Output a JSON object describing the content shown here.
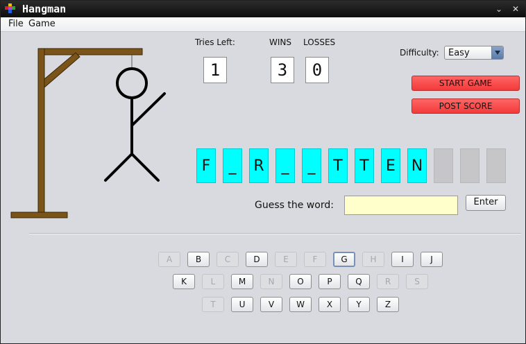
{
  "window": {
    "title": "Hangman"
  },
  "menu": {
    "file": "File",
    "game": "Game"
  },
  "stats": {
    "tries_label": "Tries Left:",
    "tries_value": "1",
    "wins_label": "WINS",
    "wins_value": "3",
    "losses_label": "LOSSES",
    "losses_value": "0"
  },
  "difficulty": {
    "label": "Difficulty:",
    "value": "Easy"
  },
  "buttons": {
    "start": "START GAME",
    "post": "POST SCORE",
    "enter": "Enter"
  },
  "word": {
    "letters": [
      "F",
      "_",
      "R",
      "_",
      "_",
      "T",
      "T",
      "E",
      "N",
      "",
      "",
      ""
    ],
    "filled_count": 9
  },
  "guess": {
    "label": "Guess the word:",
    "value": ""
  },
  "keyboard": {
    "row1": [
      {
        "letter": "A",
        "state": "disabled"
      },
      {
        "letter": "B",
        "state": "enabled"
      },
      {
        "letter": "C",
        "state": "disabled"
      },
      {
        "letter": "D",
        "state": "enabled"
      },
      {
        "letter": "E",
        "state": "disabled"
      },
      {
        "letter": "F",
        "state": "disabled"
      },
      {
        "letter": "G",
        "state": "focused"
      },
      {
        "letter": "H",
        "state": "disabled"
      },
      {
        "letter": "I",
        "state": "enabled"
      },
      {
        "letter": "J",
        "state": "enabled"
      }
    ],
    "row2": [
      {
        "letter": "K",
        "state": "enabled"
      },
      {
        "letter": "L",
        "state": "disabled"
      },
      {
        "letter": "M",
        "state": "enabled"
      },
      {
        "letter": "N",
        "state": "disabled"
      },
      {
        "letter": "O",
        "state": "enabled"
      },
      {
        "letter": "P",
        "state": "enabled"
      },
      {
        "letter": "Q",
        "state": "enabled"
      },
      {
        "letter": "R",
        "state": "disabled"
      },
      {
        "letter": "S",
        "state": "disabled"
      }
    ],
    "row3": [
      {
        "letter": "T",
        "state": "disabled"
      },
      {
        "letter": "U",
        "state": "enabled"
      },
      {
        "letter": "V",
        "state": "enabled"
      },
      {
        "letter": "W",
        "state": "enabled"
      },
      {
        "letter": "X",
        "state": "enabled"
      },
      {
        "letter": "Y",
        "state": "enabled"
      },
      {
        "letter": "Z",
        "state": "enabled"
      }
    ]
  },
  "colors": {
    "slot_filled": "#00ffff",
    "slot_empty": "#c6c6c8",
    "red_button": "#f23a3a",
    "guess_field": "#ffffcc",
    "gallows_wood": "#7a5418"
  },
  "icons": {
    "app": "app-icon",
    "minimize": "chevron-down-icon",
    "close": "close-icon"
  }
}
